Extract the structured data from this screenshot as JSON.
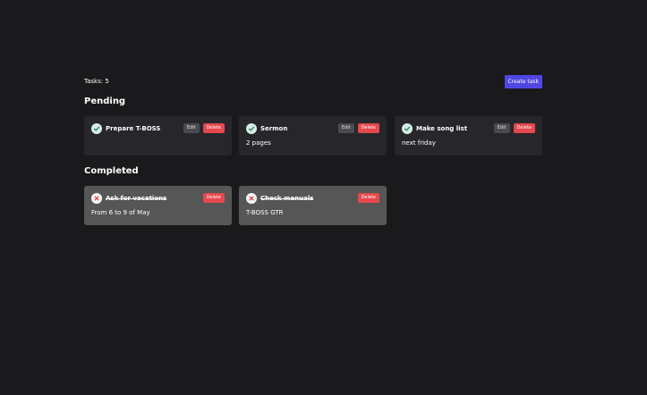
{
  "header": {
    "task_count": "Tasks: 5",
    "create_label": "Create task"
  },
  "sections": {
    "pending_title": "Pending",
    "completed_title": "Completed"
  },
  "pending": [
    {
      "title": "Prepare T-BOSS",
      "description": "",
      "edit_label": "Edit",
      "delete_label": "Delete"
    },
    {
      "title": "Sermon",
      "description": "2 pages",
      "edit_label": "Edit",
      "delete_label": "Delete"
    },
    {
      "title": "Make song list",
      "description": "next friday",
      "edit_label": "Edit",
      "delete_label": "Delete"
    }
  ],
  "completed": [
    {
      "title": "Ask for vacations",
      "description": "From 6 to 9 of May",
      "delete_label": "Delete"
    },
    {
      "title": "Check manuals",
      "description": "T-BOSS GTR",
      "delete_label": "Delete"
    }
  ],
  "colors": {
    "background": "#1a191c",
    "accent": "#4f46e5",
    "delete": "#e5484d",
    "pending_card": "#27262a",
    "completed_card": "#565657",
    "check_icon": "#2f8a64",
    "cross_icon": "#e5484d"
  },
  "icons": {
    "pending": "check-circle-icon",
    "completed": "x-circle-icon"
  }
}
